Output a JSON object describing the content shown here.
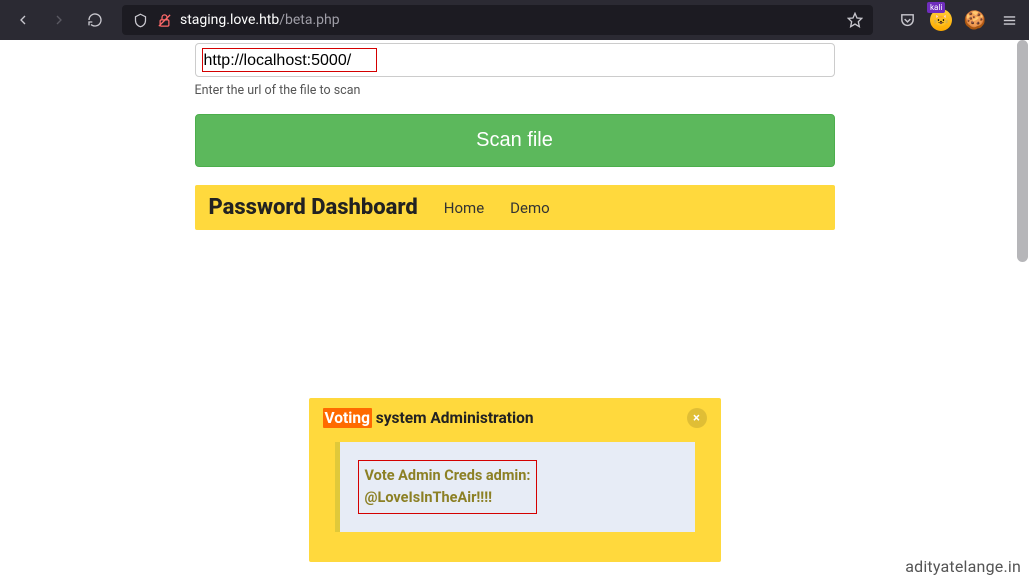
{
  "browser": {
    "url_domain": "staging.love.htb",
    "url_path": "/beta.php",
    "kali_label": "kali"
  },
  "form": {
    "url_value": "http://localhost:5000/",
    "helper": "Enter the url of the file to scan",
    "scan_label": "Scan file"
  },
  "dashboard": {
    "title": "Password Dashboard",
    "links": [
      "Home",
      "Demo"
    ]
  },
  "admin": {
    "title_highlight": "Voting",
    "title_rest": " system Administration",
    "close_symbol": "×",
    "cred_line1": "Vote Admin Creds admin:",
    "cred_line2": "@LoveIsInTheAir!!!!"
  },
  "watermark": "adityatelange.in"
}
